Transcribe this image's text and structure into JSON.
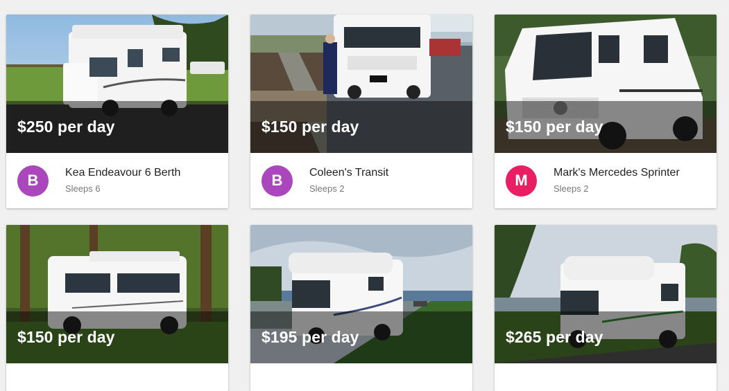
{
  "listings": [
    {
      "price": "$250 per day",
      "title": "Kea Endeavour 6 Berth",
      "subtitle": "Sleeps 6",
      "avatar_letter": "B",
      "avatar_color": "#ab47bc"
    },
    {
      "price": "$150 per day",
      "title": "Coleen's Transit",
      "subtitle": "Sleeps 2",
      "avatar_letter": "B",
      "avatar_color": "#ab47bc"
    },
    {
      "price": "$150 per day",
      "title": "Mark's Mercedes Sprinter",
      "subtitle": "Sleeps 2",
      "avatar_letter": "M",
      "avatar_color": "#e91e63"
    },
    {
      "price": "$150 per day"
    },
    {
      "price": "$195 per day"
    },
    {
      "price": "$265 per day"
    }
  ]
}
